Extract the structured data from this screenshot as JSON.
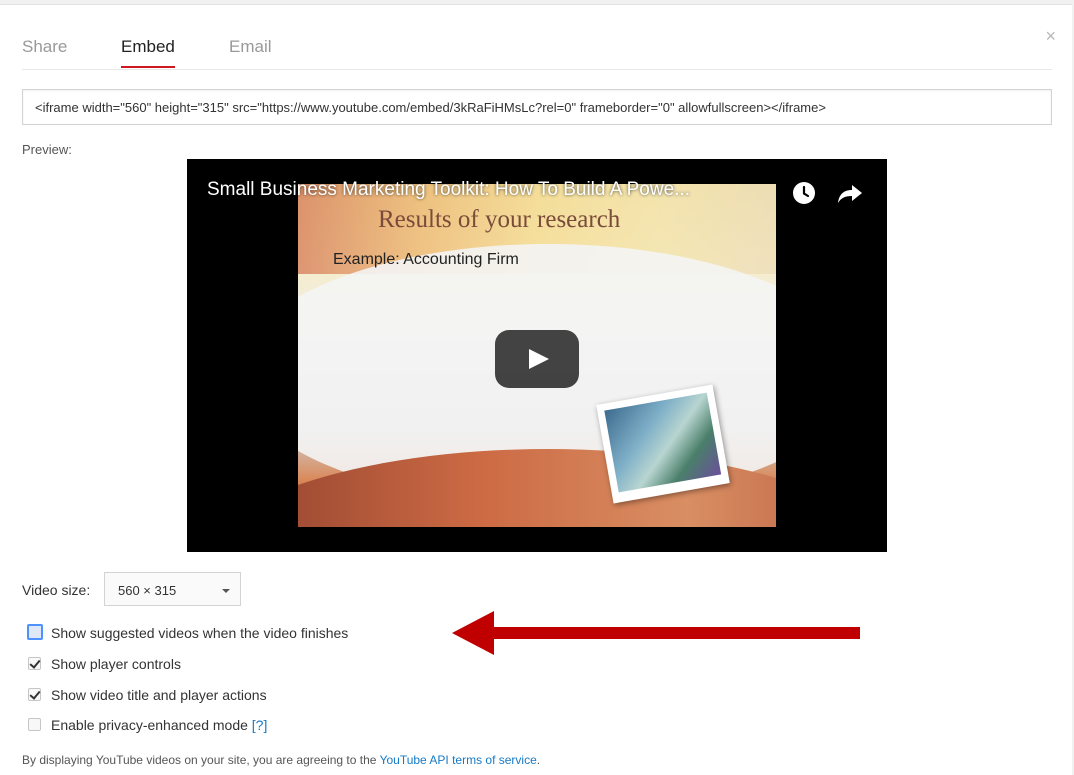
{
  "tabs": [
    {
      "label": "Share",
      "active": false
    },
    {
      "label": "Embed",
      "active": true
    },
    {
      "label": "Email",
      "active": false
    }
  ],
  "close_symbol": "×",
  "embed_code": "<iframe width=\"560\" height=\"315\" src=\"https://www.youtube.com/embed/3kRaFiHMsLc?rel=0\" frameborder=\"0\" allowfullscreen></iframe>",
  "preview_label": "Preview:",
  "player": {
    "title": "Small Business Marketing Toolkit: How To Build A Powe...",
    "slide_title": "Results of your research",
    "slide_subtitle": "Example: Accounting Firm",
    "icons": [
      "watch-later-icon",
      "share-icon",
      "play-icon"
    ]
  },
  "video_size": {
    "label": "Video size:",
    "selected": "560 × 315"
  },
  "options": [
    {
      "label": "Show suggested videos when the video finishes",
      "checked": false
    },
    {
      "label": "Show player controls",
      "checked": true
    },
    {
      "label": "Show video title and player actions",
      "checked": true
    },
    {
      "label": "Enable privacy-enhanced mode",
      "checked": false,
      "help": "[?]"
    }
  ],
  "footer": {
    "text": "By displaying YouTube videos on your site, you are agreeing to the ",
    "link": "YouTube API terms of service",
    "end": "."
  },
  "colors": {
    "accent_red": "#cc181e",
    "link_blue": "#167ac6",
    "annotation_arrow": "#c00000",
    "focus_blue": "#4d90fe"
  }
}
